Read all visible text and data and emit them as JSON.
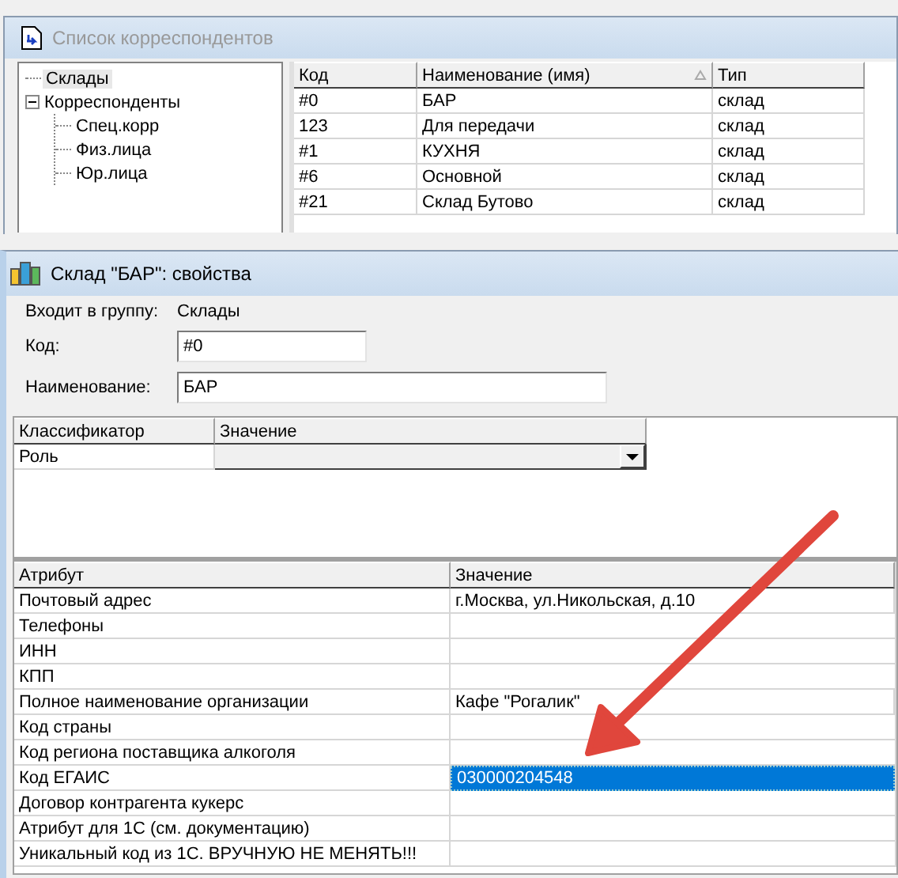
{
  "back_window": {
    "title": "Список корреспондентов",
    "tree": [
      {
        "label": "Склады",
        "selected": true
      },
      {
        "label": "Корреспонденты",
        "selected": false,
        "expanded": true,
        "children": [
          {
            "label": "Спец.корр",
            "selected": false
          },
          {
            "label": "Физ.лица",
            "selected": false
          },
          {
            "label": "Юр.лица",
            "selected": false
          }
        ]
      }
    ],
    "table": {
      "columns": [
        {
          "label": "Код",
          "sorted": false
        },
        {
          "label": "Наименование (имя)",
          "sorted": true
        },
        {
          "label": "Тип",
          "sorted": false
        }
      ],
      "rows": [
        [
          "#0",
          "БАР",
          "склад"
        ],
        [
          "123",
          "Для передачи",
          "склад"
        ],
        [
          "#1",
          "КУХНЯ",
          "склад"
        ],
        [
          "#6",
          "Основной",
          "склад"
        ],
        [
          "#21",
          "Склад Бутово",
          "склад"
        ]
      ]
    }
  },
  "properties_window": {
    "title": "Склад \"БАР\": свойства",
    "group_label": "Входит в группу:",
    "group_value": "Склады",
    "fields": [
      {
        "label": "Код:",
        "value": "#0"
      },
      {
        "label": "Наименование:",
        "value": "БАР"
      }
    ],
    "classifiers": {
      "columns": [
        "Классификатор",
        "Значение"
      ],
      "rows": [
        {
          "name": "Роль"
        }
      ]
    },
    "attributes": {
      "columns": [
        "Атрибут",
        "Значение"
      ],
      "rows": [
        {
          "name": "Почтовый адрес",
          "value": "г.Москва, ул.Никольская, д.10",
          "selected": false
        },
        {
          "name": "Телефоны",
          "selected": false
        },
        {
          "name": "ИНН",
          "selected": false
        },
        {
          "name": "КПП",
          "selected": false
        },
        {
          "name": "Полное наименование организации",
          "value": "Кафе \"Рогалик\"",
          "selected": false
        },
        {
          "name": "Код страны",
          "selected": false
        },
        {
          "name": "Код региона поставщика алкоголя",
          "selected": false
        },
        {
          "name": "Код ЕГАИС",
          "value": "030000204548",
          "selected": true
        },
        {
          "name": "Договор контрагента кукерс",
          "selected": false
        },
        {
          "name": "Атрибут для 1С (см. документацию)",
          "selected": false
        },
        {
          "name": "Уникальный код из 1С. ВРУЧНУЮ НЕ МЕНЯТЬ!!!",
          "selected": false
        }
      ]
    }
  }
}
